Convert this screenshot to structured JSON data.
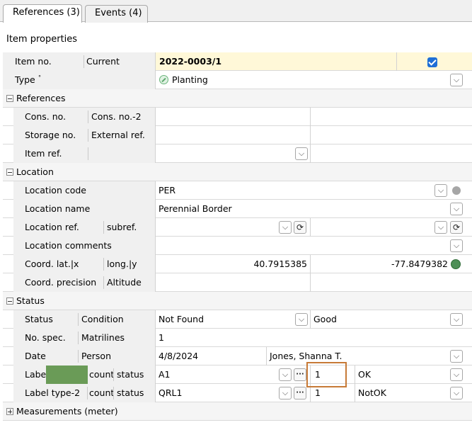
{
  "tabs": [
    {
      "label": "References (3)",
      "active": true
    },
    {
      "label": "Events (4)",
      "active": false
    }
  ],
  "panel": {
    "title": "Item properties"
  },
  "item": {
    "item_no_label": "Item no.",
    "current_label": "Current",
    "item_no_value": "2022-0003/1",
    "type_label": "Type",
    "type_value": "Planting",
    "current_checked": true
  },
  "sections": {
    "references": "References",
    "location": "Location",
    "status": "Status",
    "measurements": "Measurements (meter)"
  },
  "references": {
    "cons_no_label": "Cons. no.",
    "cons_no2_label": "Cons. no.-2",
    "storage_no_label": "Storage no.",
    "external_ref_label": "External ref.",
    "item_ref_label": "Item ref."
  },
  "location": {
    "code_label": "Location code",
    "code_value": "PER",
    "name_label": "Location name",
    "name_value": "Perennial Border",
    "ref_label": "Location ref.",
    "subref_label": "subref.",
    "comments_label": "Location comments",
    "coord_lat_label": "Coord. lat.|x",
    "long_label": "long.|y",
    "lat_value": "40.7915385",
    "long_value": "-77.8479382",
    "precision_label": "Coord. precision",
    "altitude_label": "Altitude"
  },
  "status": {
    "status_label": "Status",
    "condition_label": "Condition",
    "status_value": "Not Found",
    "condition_value": "Good",
    "no_spec_label": "No. spec.",
    "matrilines_label": "Matrilines",
    "no_spec_value": "1",
    "date_label": "Date",
    "person_label": "Person",
    "date_value": "4/8/2024",
    "person_value": "Jones, Shanna T.",
    "label_type_label": "Labe",
    "count_label": "count",
    "status_sub_label": "status",
    "label_type_value": "A1",
    "label_count_value": "1",
    "label_status_value": "OK",
    "label_type2_label": "Label type-2",
    "label_type2_value": "QRL1",
    "label2_count_value": "1",
    "label2_status_value": "NotOK"
  },
  "symbols": {
    "dropdown": "⌵",
    "ellipsis": "···",
    "refresh": "⟳"
  },
  "colors": {
    "current_row_bg": "#fff8d8",
    "highlight_box": "#c77a37",
    "checkbox_blue": "#1e6fd6",
    "redaction_green": "#6a9b57"
  }
}
